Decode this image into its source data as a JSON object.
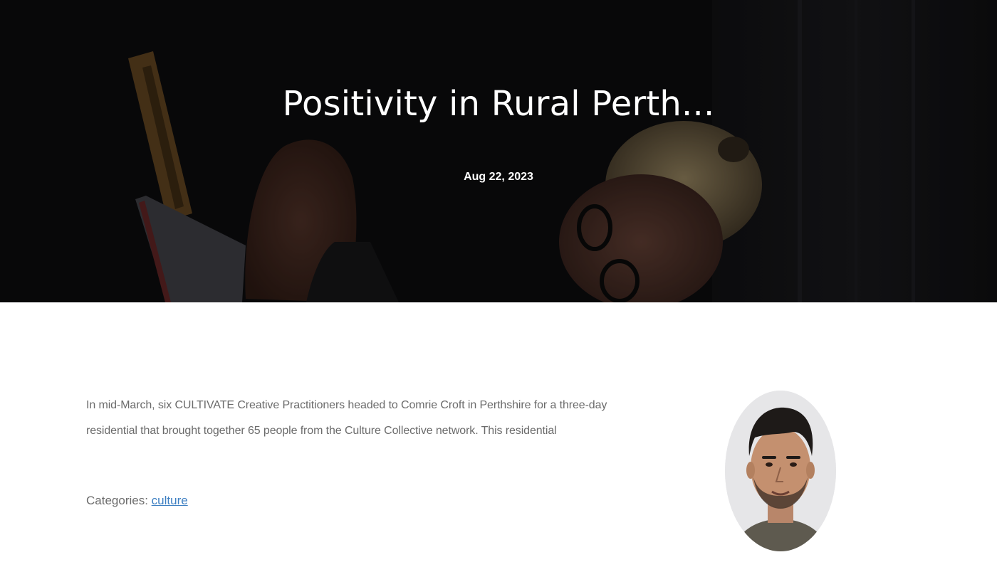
{
  "hero": {
    "title": "Positivity in Rural Perth...",
    "date": "Aug 22, 2023"
  },
  "post": {
    "excerpt": "In mid-March, six CULTIVATE Creative Practitioners headed to Comrie Croft in Perthshire for a three-day residential that brought together 65 people from the Culture Collective network. This residential",
    "categories_label": "Categories:",
    "category_link": "culture"
  },
  "author": {
    "avatar_icon": "person-portrait"
  },
  "colors": {
    "hero_background": "#0b0b0d",
    "body_text": "#6b6b6b",
    "link": "#3d7fc2"
  }
}
